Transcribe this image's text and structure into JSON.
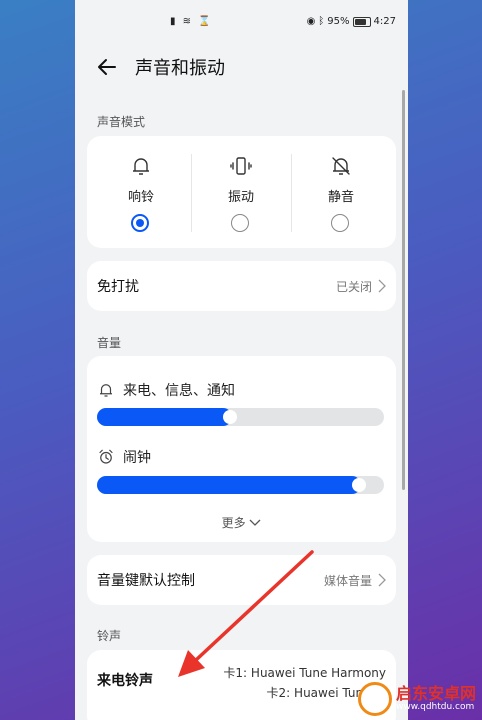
{
  "status_bar": {
    "center_icons": "▮ ≋ ⌛",
    "battery_percent": "95%",
    "time": "4:27"
  },
  "header": {
    "title": "声音和振动"
  },
  "sound_mode": {
    "section_label": "声音模式",
    "options": [
      {
        "label": "响铃",
        "icon": "bell-icon",
        "selected": true
      },
      {
        "label": "振动",
        "icon": "vibrate-icon",
        "selected": false
      },
      {
        "label": "静音",
        "icon": "bell-off-icon",
        "selected": false
      }
    ]
  },
  "do_not_disturb": {
    "label": "免打扰",
    "value": "已关闭"
  },
  "volume": {
    "section_label": "音量",
    "sliders": [
      {
        "label": "来电、信息、通知",
        "icon": "bell-icon",
        "level_percent": 47
      },
      {
        "label": "闹钟",
        "icon": "alarm-clock-icon",
        "level_percent": 92
      }
    ],
    "more_label": "更多"
  },
  "volume_key": {
    "label": "音量键默认控制",
    "value": "媒体音量"
  },
  "ringtone": {
    "section_label": "铃声",
    "label": "来电铃声",
    "sim1": "卡1: Huawei Tune Harmony",
    "sim2": "卡2: Huawei Tune Cl"
  },
  "watermark": {
    "title": "启东安卓网",
    "url": "www.qdhtdu.com"
  },
  "colors": {
    "accent": "#0a59f7",
    "arrow": "#e8342a"
  }
}
